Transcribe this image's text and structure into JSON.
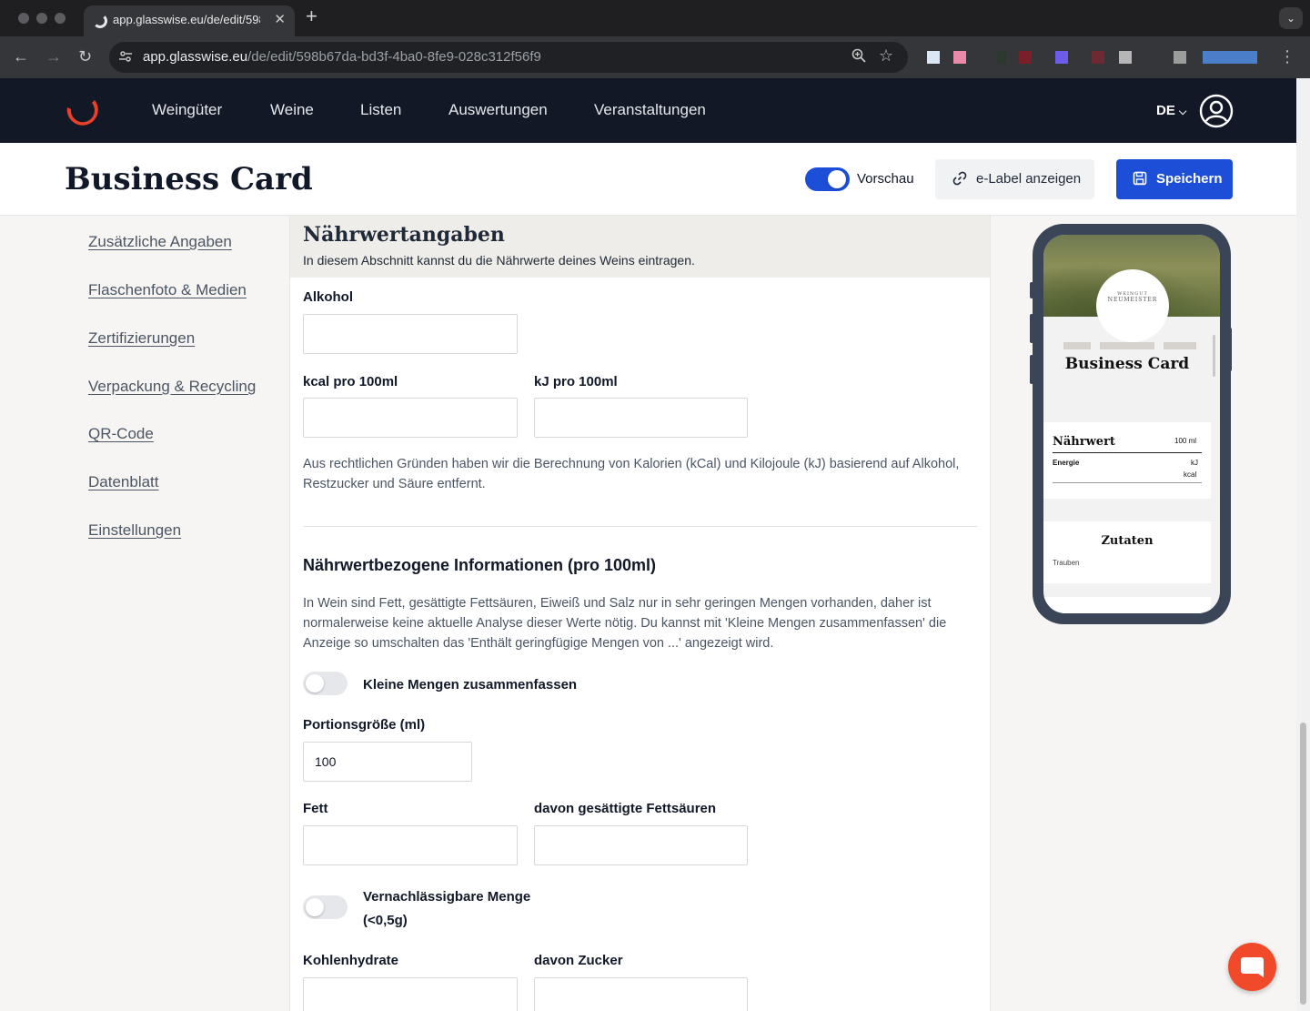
{
  "browser": {
    "tab_title": "app.glasswise.eu/de/edit/598b67da-bd3f-4ba0-8fe9-028c312f56f9",
    "url_host": "app.glasswise.eu",
    "url_path": "/de/edit/598b67da-bd3f-4ba0-8fe9-028c312f56f9",
    "new_tab_glyph": "+",
    "close_glyph": "✕"
  },
  "nav": {
    "items": [
      "Weingüter",
      "Weine",
      "Listen",
      "Auswertungen",
      "Veranstaltungen"
    ],
    "language": "DE"
  },
  "header": {
    "title": "Business Card",
    "preview_label": "Vorschau",
    "preview_on": true,
    "elabel_button": "e-Label anzeigen",
    "save_button": "Speichern"
  },
  "sidebar": {
    "items": [
      "Zusätzliche Angaben",
      "Flaschenfoto & Medien",
      "Zertifizierungen",
      "Verpackung & Recycling",
      "QR-Code",
      "Datenblatt",
      "Einstellungen"
    ]
  },
  "form": {
    "section_title": "Nährwertangaben",
    "section_desc": "In diesem Abschnitt kannst du die Nährwerte deines Weins eintragen.",
    "alcohol_label": "Alkohol",
    "alcohol_value": "",
    "kcal_label": "kcal pro 100ml",
    "kj_label": "kJ pro 100ml",
    "legal_note": "Aus rechtlichen Gründen haben wir die Berechnung von Kalorien (kCal) und Kilojoule (kJ) basierend auf Alkohol, Restzucker und Säure entfernt.",
    "sub_title": "Nährwertbezogene Informationen (pro 100ml)",
    "sub_note": "In Wein sind Fett, gesättigte Fettsäuren, Eiweiß und Salz nur in sehr geringen Mengen vorhanden, daher ist normalerweise keine aktuelle Analyse dieser Werte nötig. Du kannst mit 'Kleine Mengen zusammenfassen' die Anzeige so umschalten das 'Enthält geringfügige Mengen von ...' angezeigt wird.",
    "small_amounts_label": "Kleine Mengen zusammenfassen",
    "small_amounts_on": false,
    "portion_label": "Portionsgröße (ml)",
    "portion_value": "100",
    "fat_label": "Fett",
    "satfat_label": "davon gesättigte Fettsäuren",
    "negligible_label_1": "Vernachlässigbare Menge",
    "negligible_label_2": "(<0,5g)",
    "negligible_on": false,
    "carbs_label": "Kohlenhydrate",
    "sugar_label": "davon Zucker"
  },
  "preview": {
    "logo_text": "NEUMEISTER",
    "logo_sub": "WEINGUT",
    "title": "Business Card",
    "nutrition_title": "Nährwert",
    "per_label": "100 ml",
    "energy_label": "Energie",
    "kj_unit": "kJ",
    "kcal_unit": "kcal",
    "ingredients_title": "Zutaten",
    "ingredients_value": "Trauben"
  },
  "colors": {
    "nav_bg": "#121826",
    "primary": "#1d4ed8",
    "brand_red": "#e8402a",
    "section_bg": "#efede9"
  }
}
